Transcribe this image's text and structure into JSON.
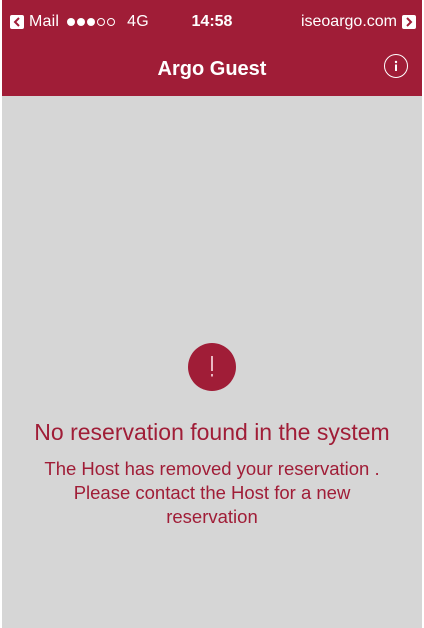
{
  "status_bar": {
    "back_app": "Mail",
    "signal_bars": [
      true,
      true,
      true,
      false,
      false
    ],
    "network": "4G",
    "time": "14:58",
    "domain": "iseoargo.com"
  },
  "nav_bar": {
    "title": "Argo Guest",
    "info_icon": "info-icon"
  },
  "main": {
    "alert_icon": "exclamation-icon",
    "headline": "No reservation found in the system",
    "message": "The Host has removed your reservation . Please contact the Host for a new reservation"
  },
  "colors": {
    "brand": "#a01d37",
    "background": "#d6d6d6",
    "on_brand": "#ffffff"
  }
}
